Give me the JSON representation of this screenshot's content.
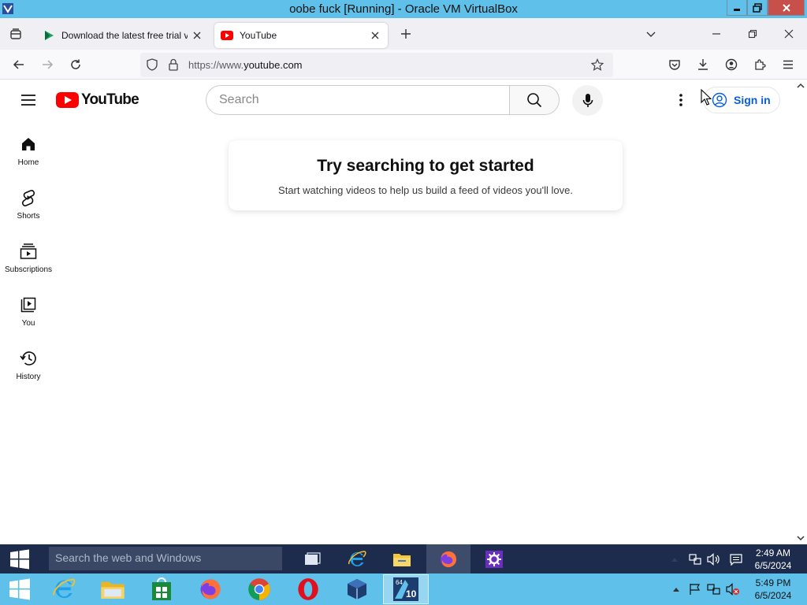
{
  "vbox": {
    "title": "oobe fuck [Running] - Oracle VM VirtualBox"
  },
  "firefox": {
    "tabs": [
      {
        "label": "Download the latest free trial v",
        "favicon": "green-play-icon",
        "active": false
      },
      {
        "label": "YouTube",
        "favicon": "youtube-icon",
        "active": true
      }
    ],
    "url": {
      "prefix": "https://www.",
      "domain": "youtube.com"
    }
  },
  "youtube": {
    "logo_text": "YouTube",
    "search_placeholder": "Search",
    "sign_in_label": "Sign in",
    "sidebar": [
      {
        "label": "Home",
        "icon": "home-icon"
      },
      {
        "label": "Shorts",
        "icon": "shorts-icon"
      },
      {
        "label": "Subscriptions",
        "icon": "subscriptions-icon"
      },
      {
        "label": "You",
        "icon": "you-icon"
      },
      {
        "label": "History",
        "icon": "history-icon"
      }
    ],
    "empty_state": {
      "heading": "Try searching to get started",
      "subtext": "Start watching videos to help us build a feed of videos you'll love."
    },
    "colors": {
      "brand_red": "#ff0000",
      "link_blue": "#065fd4"
    }
  },
  "guest_taskbar": {
    "search_placeholder": "Search the web and Windows",
    "time": "2:49 AM",
    "date": "6/5/2024"
  },
  "host_taskbar": {
    "time": "5:49 PM",
    "date": "6/5/2024",
    "badge": "10"
  }
}
